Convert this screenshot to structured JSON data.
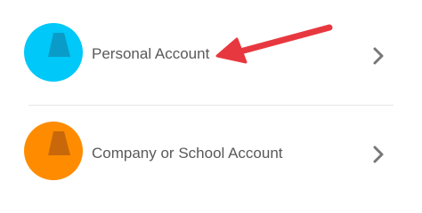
{
  "accounts": [
    {
      "label": "Personal Account",
      "icon": "personal-account-icon",
      "color": "#00C8F8",
      "mark_color": "#0A9CC8"
    },
    {
      "label": "Company or School Account",
      "icon": "company-account-icon",
      "color": "#FF8C00",
      "mark_color": "#C8680A"
    }
  ],
  "chevron_icon": "chevron-right-icon",
  "annotation": {
    "icon": "red-arrow-icon",
    "color": "#E8383F"
  }
}
